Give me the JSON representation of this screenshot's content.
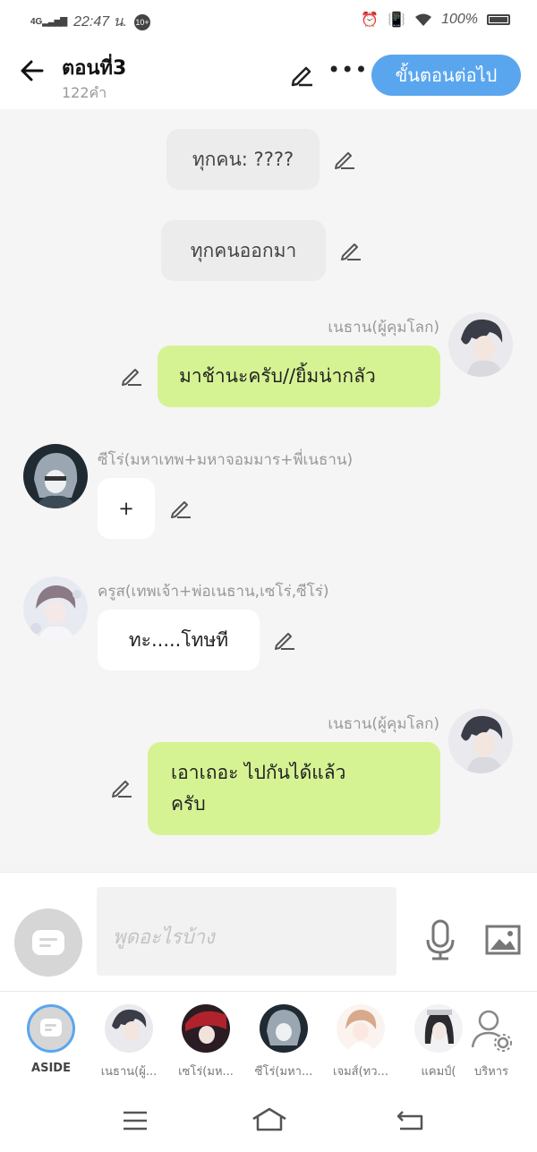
{
  "status_bar": {
    "network": "4G",
    "time": "22:47 น.",
    "notification_count": "10+",
    "battery": "100%"
  },
  "header": {
    "back_icon": "arrow-left-icon",
    "title": "ตอนที่3",
    "word_count": "122คำ",
    "next_button": "ขั้นตอนต่อไป",
    "accent": "#5aa6ee"
  },
  "messages": [
    {
      "type": "narration",
      "text": "ทุกคน: ????"
    },
    {
      "type": "narration",
      "text": "ทุกคนออกมา"
    },
    {
      "type": "right",
      "name": "เนธาน(ผู้คุมโลก)",
      "text": "มาช้านะครับ//ยิ้มน่ากลัว"
    },
    {
      "type": "left",
      "name": "ซีโร่(มหาเทพ+มหาจอมมาร+พี่เนธาน)",
      "text": "+"
    },
    {
      "type": "left",
      "name": "ครูส(เทพเจ้า+พ่อเนธาน,เซโร่,ซีโร่)",
      "text": "ทะ.....โทษที"
    },
    {
      "type": "right",
      "name": "เนธาน(ผู้คุมโลก)",
      "text_line1": "เอาเถอะ ไปกันได้แล้ว",
      "text_line2": "ครับ"
    }
  ],
  "composer": {
    "placeholder": "พูดอะไรบ้าง",
    "mic_icon": "microphone-icon",
    "image_icon": "image-icon"
  },
  "characters": [
    {
      "label": "ASIDE"
    },
    {
      "label": "เนธาน(ผู้..."
    },
    {
      "label": "เซโร่(มห..."
    },
    {
      "label": "ซีโร่(มหา..."
    },
    {
      "label": "เจมส์(ทว..."
    },
    {
      "label": "แคมป์("
    },
    {
      "label": "บริหาร"
    }
  ],
  "colors": {
    "bubble_right": "#d6f394",
    "bubble_left": "#ffffff",
    "bubble_narration": "#ececec"
  }
}
